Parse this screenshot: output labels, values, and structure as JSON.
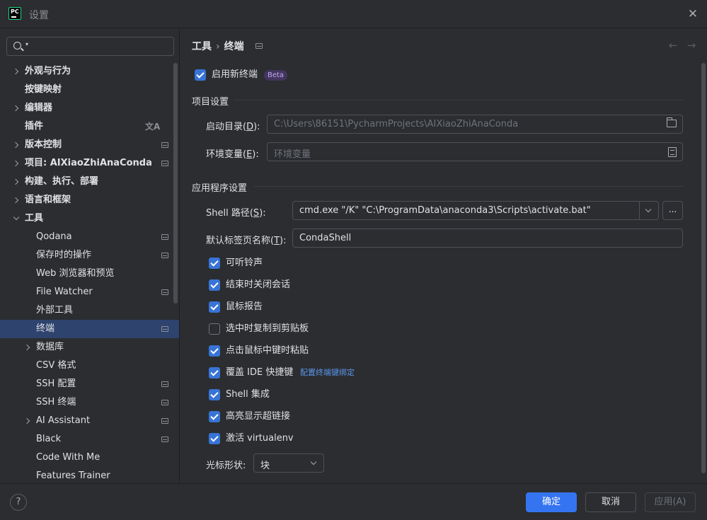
{
  "window": {
    "title": "设置",
    "logo": "PC"
  },
  "search": {
    "placeholder": ""
  },
  "sidebar": {
    "items": [
      {
        "label": "外观与行为",
        "chevron": "right",
        "bold": true
      },
      {
        "label": "按键映射",
        "bold": true
      },
      {
        "label": "编辑器",
        "chevron": "right",
        "bold": true
      },
      {
        "label": "插件",
        "bold": true,
        "translate_icon": "文A"
      },
      {
        "label": "版本控制",
        "chevron": "right",
        "bold": true
      },
      {
        "label": "项目: AIXiaoZhiAnaConda",
        "chevron": "right",
        "bold": true
      },
      {
        "label": "构建、执行、部署",
        "chevron": "right",
        "bold": true
      },
      {
        "label": "语言和框架",
        "chevron": "right",
        "bold": true
      },
      {
        "label": "工具",
        "chevron": "down",
        "bold": true
      },
      {
        "label": "Qodana"
      },
      {
        "label": "保存时的操作"
      },
      {
        "label": "Web 浏览器和预览"
      },
      {
        "label": "File Watcher"
      },
      {
        "label": "外部工具"
      },
      {
        "label": "终端",
        "selected": true
      },
      {
        "label": "数据库",
        "chevron": "right"
      },
      {
        "label": "CSV 格式"
      },
      {
        "label": "SSH 配置"
      },
      {
        "label": "SSH 终端"
      },
      {
        "label": "AI Assistant",
        "chevron": "right"
      },
      {
        "label": "Black"
      },
      {
        "label": "Code With Me"
      },
      {
        "label": "Features Trainer"
      }
    ]
  },
  "breadcrumb": {
    "parent": "工具",
    "separator": "›",
    "current": "终端"
  },
  "nav": {
    "back": "←",
    "forward": "→"
  },
  "main": {
    "enable_new_terminal": {
      "label": "启用新终端",
      "checked": true,
      "badge": "Beta"
    },
    "project_section": {
      "title": "项目设置"
    },
    "start_dir": {
      "label_pre": "启动目录(",
      "mnemonic": "D",
      "label_post": "):",
      "value": "C:\\Users\\86151\\PycharmProjects\\AIXiaoZhiAnaConda"
    },
    "env_vars": {
      "label_pre": "环境变量(",
      "mnemonic": "E",
      "label_post": "):",
      "placeholder": "环境变量"
    },
    "app_section": {
      "title": "应用程序设置"
    },
    "shell_path": {
      "label_pre": "Shell 路径(",
      "mnemonic": "S",
      "label_post": "):",
      "value": "cmd.exe \"/K\" \"C:\\ProgramData\\anaconda3\\Scripts\\activate.bat\"",
      "ellipsis": "..."
    },
    "tab_name": {
      "label_pre": "默认标签页名称(",
      "mnemonic": "T",
      "label_post": "):",
      "value": "CondaShell"
    },
    "options": [
      {
        "label": "可听铃声",
        "checked": true
      },
      {
        "label": "结束时关闭会话",
        "checked": true
      },
      {
        "label": "鼠标报告",
        "checked": true
      },
      {
        "label": "选中时复制到剪贴板",
        "checked": false
      },
      {
        "label": "点击鼠标中键时粘贴",
        "checked": true
      },
      {
        "label": "覆盖 IDE 快捷键",
        "checked": true,
        "link": "配置终端键绑定"
      },
      {
        "label": "Shell 集成",
        "checked": true
      },
      {
        "label": "高亮显示超链接",
        "checked": true
      },
      {
        "label": "激活 virtualenv",
        "checked": true
      }
    ],
    "cursor_shape": {
      "label": "光标形状:",
      "value": "块"
    }
  },
  "footer": {
    "help": "?",
    "ok": "确定",
    "cancel": "取消",
    "apply": "应用(A)"
  },
  "colors": {
    "accent": "#3574f0",
    "selected_row": "#2e436e",
    "background": "#2b2d30",
    "link": "#5b96ee"
  }
}
